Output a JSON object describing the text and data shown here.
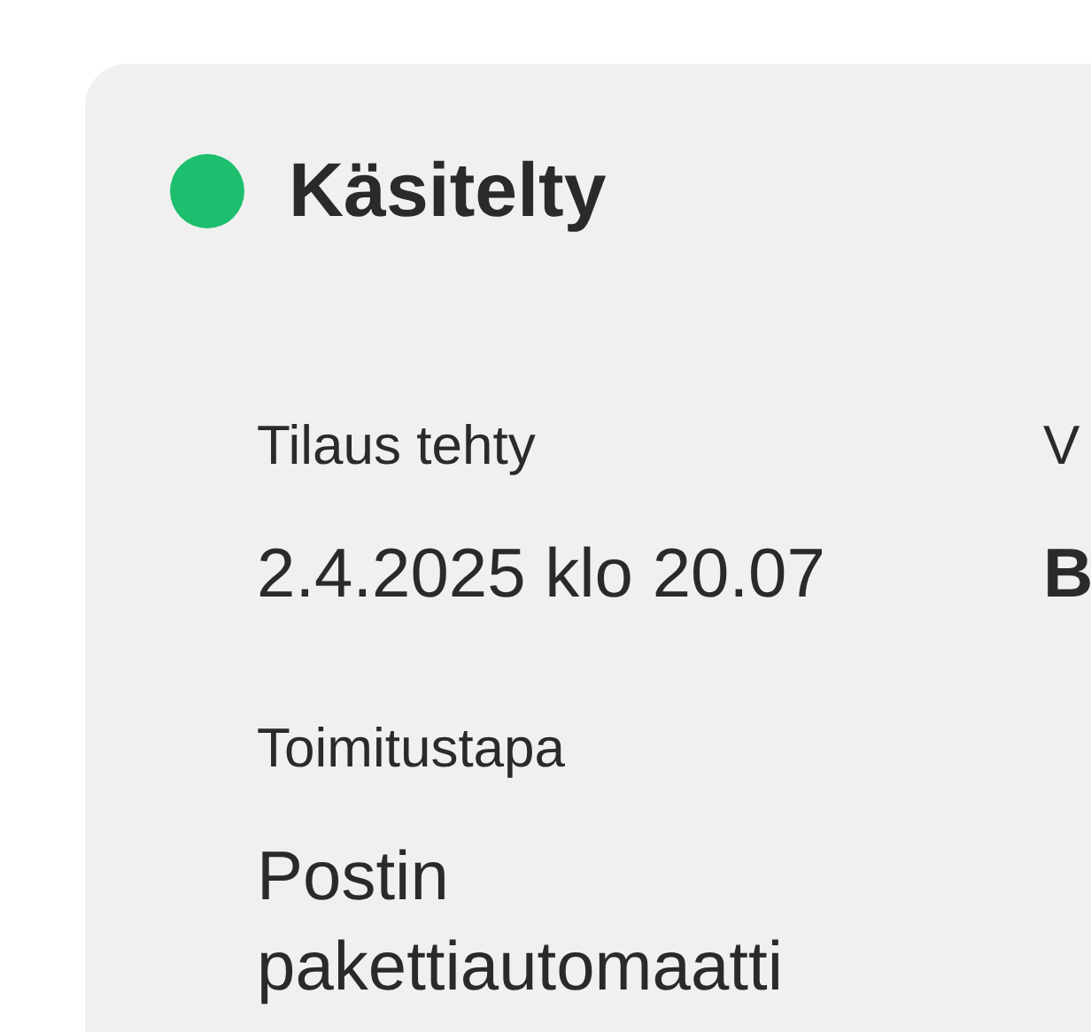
{
  "status": {
    "label": "Käsitelty",
    "color": "#1dbf6e"
  },
  "fields": [
    {
      "label": "Tilaus tehty",
      "value": "2.4.2025 klo 20.07",
      "bold": false
    },
    {
      "label": "V",
      "value": "B",
      "bold": true
    },
    {
      "label": "Toimitustapa",
      "value": "Postin pakettiautomaatti",
      "bold": false
    }
  ]
}
